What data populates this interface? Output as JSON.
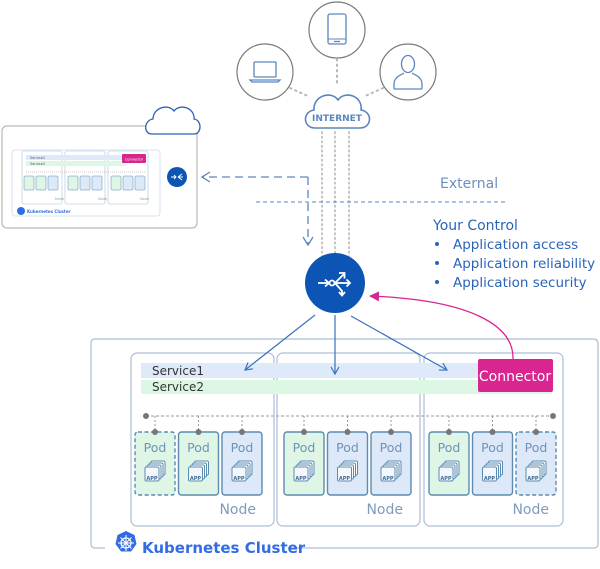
{
  "colors": {
    "primary_blue": "#0d55b4",
    "text_blue": "#2a64b8",
    "label_blue": "#6b8fbf",
    "connector_magenta": "#d9258f",
    "service1_bg": "#deeafa",
    "service2_bg": "#dcf7e4",
    "pod_green_bg": "#dff5e6",
    "pod_blue_bg": "#dde9f9",
    "pod_border": "#5b8bb0",
    "node_border": "#a9bfd8",
    "gray_circle": "#7a7a7a",
    "dotted_gray": "#b7b7b7",
    "k8s_blue": "#326ce5"
  },
  "internet": {
    "label": "INTERNET"
  },
  "devices": [
    {
      "name": "laptop",
      "icon": "laptop-icon"
    },
    {
      "name": "mobile",
      "icon": "mobile-phone-icon"
    },
    {
      "name": "user",
      "icon": "user-icon"
    }
  ],
  "boundary": {
    "external_label": "External"
  },
  "control": {
    "title": "Your Control",
    "items": [
      "Application access",
      "Application reliability",
      "Application security"
    ]
  },
  "cluster": {
    "label": "Kubernetes Cluster",
    "services": [
      "Service1",
      "Service2"
    ],
    "connector_label": "Connector",
    "nodes": [
      {
        "label": "Node",
        "pods": [
          {
            "label": "Pod",
            "app": "APP",
            "style": "green",
            "dashed": true
          },
          {
            "label": "Pod",
            "app": "APP",
            "style": "green",
            "dashed": false
          },
          {
            "label": "Pod",
            "app": "APP",
            "style": "blue",
            "dashed": false
          }
        ]
      },
      {
        "label": "Node",
        "pods": [
          {
            "label": "Pod",
            "app": "APP",
            "style": "green",
            "dashed": false
          },
          {
            "label": "Pod",
            "app": "APP",
            "style": "blue",
            "dashed": false
          },
          {
            "label": "Pod",
            "app": "APP",
            "style": "blue",
            "dashed": false
          }
        ]
      },
      {
        "label": "Node",
        "pods": [
          {
            "label": "Pod",
            "app": "APP",
            "style": "green",
            "dashed": false
          },
          {
            "label": "Pod",
            "app": "APP",
            "style": "blue",
            "dashed": false
          },
          {
            "label": "Pod",
            "app": "APP",
            "style": "blue",
            "dashed": true
          }
        ]
      }
    ]
  },
  "remote_cluster": {
    "label": "Kubernetes Cluster",
    "services": [
      "Service1",
      "Service2"
    ],
    "connector_label": "Connector",
    "node_label": "Node",
    "pod_label": "Pod"
  }
}
